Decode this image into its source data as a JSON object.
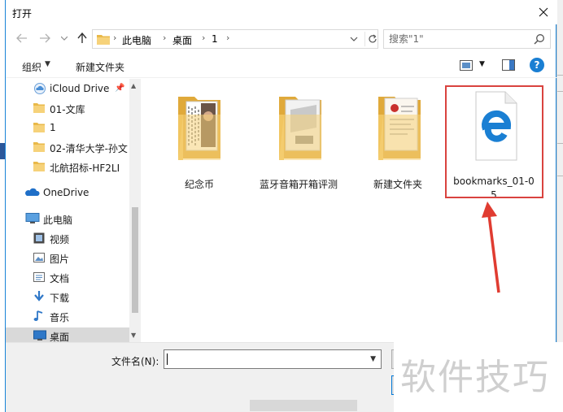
{
  "window": {
    "title": "打开"
  },
  "navigation": {
    "breadcrumb": [
      "此电脑",
      "桌面",
      "1"
    ],
    "search_placeholder": "搜索\"1\""
  },
  "toolbar": {
    "organize_label": "组织",
    "new_folder_label": "新建文件夹",
    "help_label": "?"
  },
  "sidebar": {
    "items": [
      {
        "label": "iCloud Drive",
        "icon": "icloud-icon"
      },
      {
        "label": "01-文库",
        "icon": "folder-icon"
      },
      {
        "label": "1",
        "icon": "folder-icon"
      },
      {
        "label": "02-清华大学-孙文",
        "icon": "folder-icon"
      },
      {
        "label": "北航招标-HF2LI",
        "icon": "folder-icon"
      },
      {
        "label": "OneDrive",
        "icon": "onedrive-icon"
      },
      {
        "label": "此电脑",
        "icon": "computer-icon"
      },
      {
        "label": "视频",
        "icon": "video-icon"
      },
      {
        "label": "图片",
        "icon": "pictures-icon"
      },
      {
        "label": "文档",
        "icon": "documents-icon"
      },
      {
        "label": "下载",
        "icon": "download-icon"
      },
      {
        "label": "音乐",
        "icon": "music-icon"
      },
      {
        "label": "桌面",
        "icon": "desktop-icon"
      }
    ]
  },
  "files": [
    {
      "name": "纪念币",
      "type": "folder"
    },
    {
      "name": "蓝牙音箱开箱评测",
      "type": "folder"
    },
    {
      "name": "新建文件夹",
      "type": "folder"
    },
    {
      "name": "bookmarks_01-05",
      "type": "edge-html-file"
    }
  ],
  "bottom": {
    "filename_label": "文件名(N):",
    "filename_value": ""
  },
  "watermark": "软件技巧",
  "colors": {
    "accent": "#1883d7",
    "highlight_box": "#d9433f",
    "folder": "#f3c561",
    "edge": "#1a7fd3"
  }
}
